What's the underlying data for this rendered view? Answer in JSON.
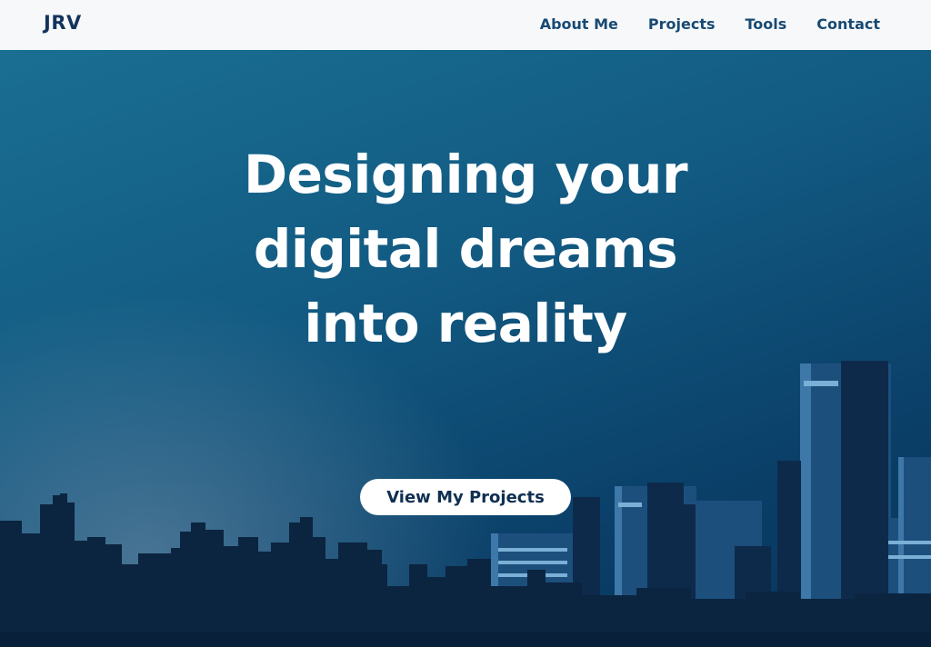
{
  "header": {
    "logo": "JRV",
    "nav": [
      {
        "label": "About Me"
      },
      {
        "label": "Projects"
      },
      {
        "label": "Tools"
      },
      {
        "label": "Contact"
      }
    ]
  },
  "hero": {
    "title": "Designing your digital dreams into reality",
    "cta_label": "View My Projects"
  },
  "colors": {
    "navbar_bg": "#f7f8fa",
    "brand_text": "#12345b",
    "hero_gradient_start": "#1a6f92",
    "hero_gradient_end": "#07345c",
    "skyline": "#0b2440",
    "cta_bg": "#ffffff",
    "cta_text": "#0f2f52"
  }
}
